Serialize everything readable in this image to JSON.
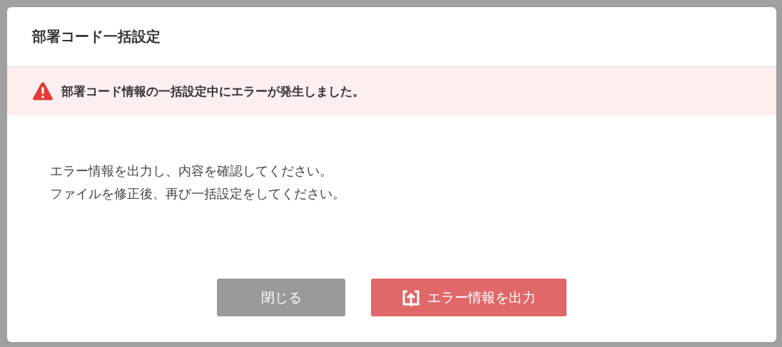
{
  "dialog": {
    "title": "部署コード一括設定",
    "alert": {
      "kind": "error",
      "message": "部署コード情報の一括設定中にエラーが発生しました。"
    },
    "body": [
      "エラー情報を出力し、内容を確認してください。",
      "ファイルを修正後、再び一括設定をしてください。"
    ],
    "buttons": [
      {
        "label": "閉じる",
        "kind": "secondary"
      },
      {
        "label": "エラー情報を出力",
        "kind": "export"
      }
    ]
  }
}
